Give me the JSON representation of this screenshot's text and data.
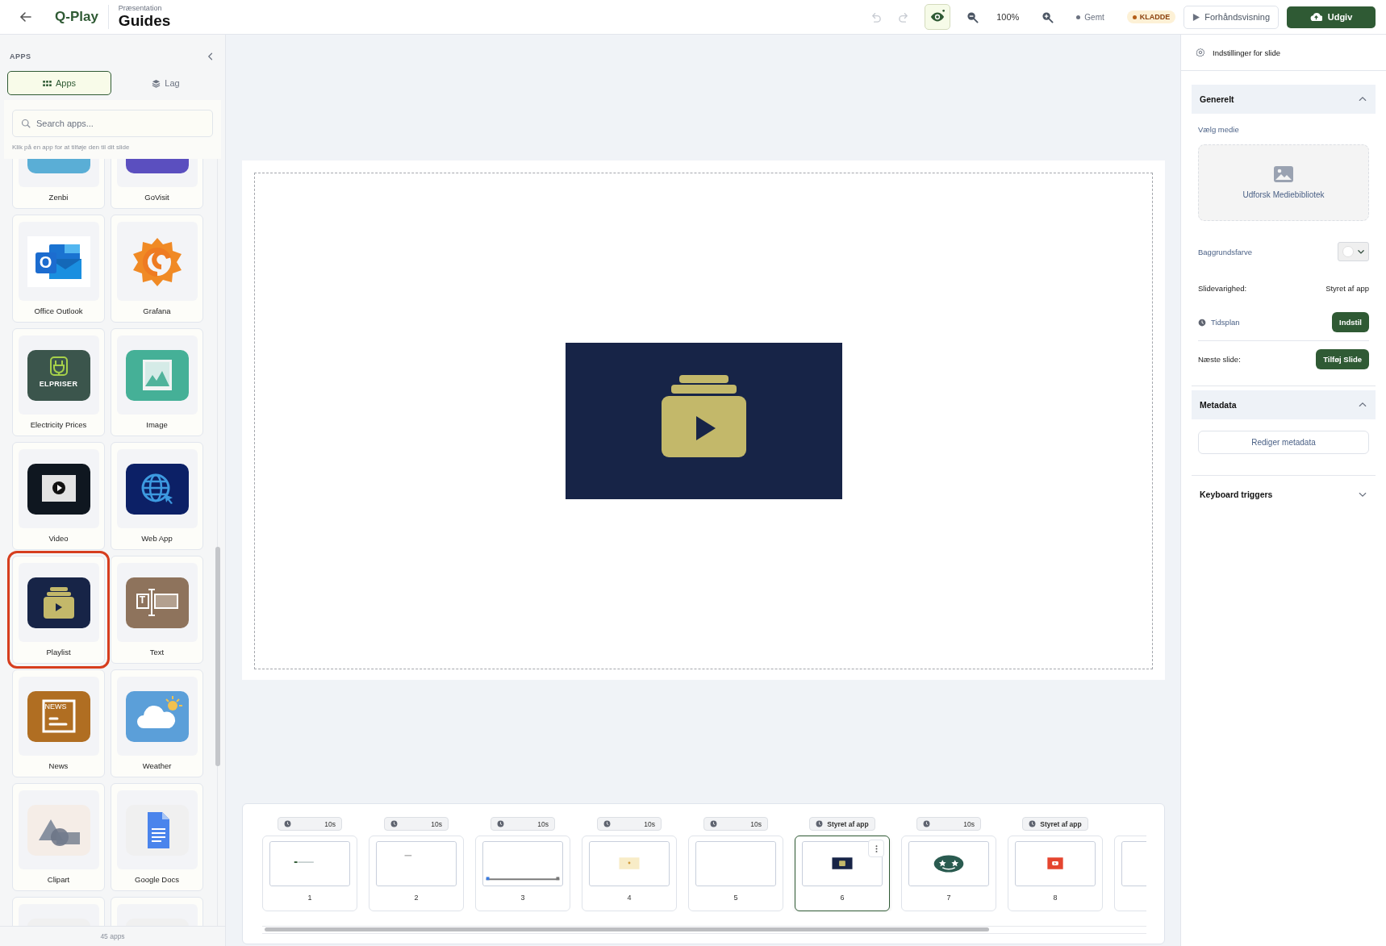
{
  "topbar": {
    "logo": "Q-Play",
    "subtitle": "Præsentation",
    "title": "Guides",
    "undo": {
      "disabled": true
    },
    "redo": {
      "disabled": true
    },
    "preview_toggle": {
      "on": true
    },
    "zoom": "100%",
    "save_status": "Gemt",
    "status_badge": "KLADDE",
    "preview_button": "Forhåndsvisning",
    "publish_button": "Udgiv"
  },
  "apps_panel": {
    "heading": "APPS",
    "tabs": [
      {
        "label": "Apps",
        "selected": true
      },
      {
        "label": "Lag",
        "selected": false
      }
    ],
    "search": {
      "placeholder": "Search apps..."
    },
    "hint": "Klik på en app for at tilføje den til dit slide",
    "apps": [
      {
        "label": "Zenbi",
        "selected": false
      },
      {
        "label": "GoVisit",
        "selected": false
      },
      {
        "label": "Office Outlook",
        "selected": false,
        "icon_text": "O"
      },
      {
        "label": "Grafana",
        "selected": false
      },
      {
        "label": "Electricity Prices",
        "selected": false,
        "icon_text": "ELPRISER"
      },
      {
        "label": "Image",
        "selected": false
      },
      {
        "label": "Video",
        "selected": false
      },
      {
        "label": "Web App",
        "selected": false
      },
      {
        "label": "Playlist",
        "selected": true
      },
      {
        "label": "Text",
        "selected": false,
        "icon_text": "T"
      },
      {
        "label": "News",
        "selected": false,
        "icon_text": "NEWS"
      },
      {
        "label": "Weather",
        "selected": false
      },
      {
        "label": "Clipart",
        "selected": false
      },
      {
        "label": "Google Docs",
        "selected": false
      },
      {
        "selected": false
      },
      {
        "selected": false
      }
    ],
    "count": "45 apps"
  },
  "filmstrip": {
    "slides": [
      {
        "duration": "10s",
        "number": "1",
        "selected": false
      },
      {
        "duration": "10s",
        "number": "2",
        "selected": false
      },
      {
        "duration": "10s",
        "number": "3",
        "selected": false
      },
      {
        "duration": "10s",
        "number": "4",
        "selected": false
      },
      {
        "duration": "10s",
        "number": "5",
        "selected": false
      },
      {
        "duration": "Styret af app",
        "number": "6",
        "selected": true
      },
      {
        "duration": "10s",
        "number": "7",
        "selected": false
      },
      {
        "duration": "Styret af app",
        "number": "8",
        "selected": false
      },
      {
        "selected": false
      }
    ]
  },
  "settings": {
    "title": "Indstillinger for slide",
    "sections": [
      {
        "kind": "general",
        "title": "Generelt",
        "expanded": true,
        "media_label": "Vælg medie",
        "media_button": "Udforsk Mediebibliotek",
        "background_label": "Baggrundsfarve",
        "duration_label": "Slidevarighed:",
        "duration_value": "Styret af app",
        "schedule_label": "Tidsplan",
        "schedule_button": "Indstil",
        "next_label": "Næste slide:",
        "next_button": "Tilføj Slide"
      },
      {
        "kind": "metadata",
        "title": "Metadata",
        "expanded": true,
        "button": "Rediger metadata"
      },
      {
        "kind": "triggers",
        "title": "Keyboard triggers",
        "expanded": false
      }
    ]
  }
}
